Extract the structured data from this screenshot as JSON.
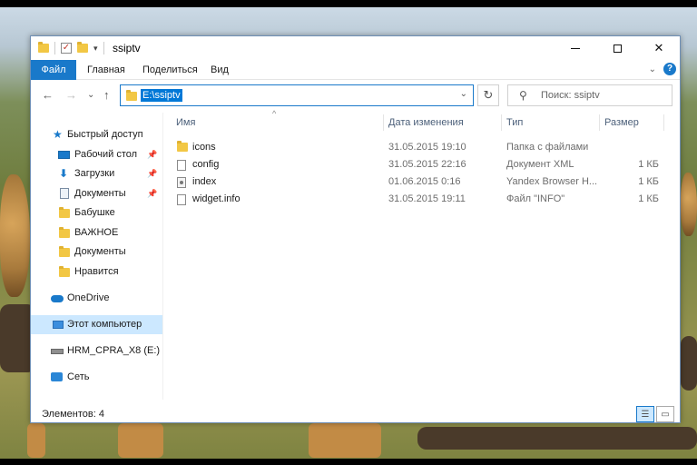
{
  "window": {
    "title": "ssiptv",
    "controls": {
      "minimize": "",
      "maximize": "",
      "close": "✕"
    }
  },
  "ribbon": {
    "tabs": [
      {
        "label": "Файл"
      },
      {
        "label": "Главная"
      },
      {
        "label": "Поделиться"
      },
      {
        "label": "Вид"
      }
    ],
    "help": "?"
  },
  "navigation": {
    "back": "←",
    "forward": "→",
    "recent": "⌄",
    "up": "↑",
    "address_path": "E:\\ssiptv",
    "refresh": "↻",
    "search_placeholder": "Поиск: ssiptv"
  },
  "sidebar": {
    "quick_access": "Быстрый доступ",
    "items": [
      {
        "label": "Рабочий стол",
        "icon": "desktop-icon",
        "pinned": true
      },
      {
        "label": "Загрузки",
        "icon": "download-icon",
        "pinned": true
      },
      {
        "label": "Документы",
        "icon": "document-icon",
        "pinned": true
      },
      {
        "label": "Бабушке",
        "icon": "folder-icon",
        "pinned": false
      },
      {
        "label": "ВАЖНОЕ",
        "icon": "folder-icon",
        "pinned": false
      },
      {
        "label": "Документы",
        "icon": "folder-icon",
        "pinned": false
      },
      {
        "label": "Нравится",
        "icon": "folder-icon",
        "pinned": false
      }
    ],
    "onedrive": "OneDrive",
    "this_pc": "Этот компьютер",
    "drive": "HRM_CPRA_X8 (E:)",
    "network": "Сеть"
  },
  "filelist": {
    "columns": {
      "name": "Имя",
      "date": "Дата изменения",
      "type": "Тип",
      "size": "Размер"
    },
    "rows": [
      {
        "name": "icons",
        "date": "31.05.2015 19:10",
        "type": "Папка с файлами",
        "size": "",
        "icon": "folder-icon"
      },
      {
        "name": "config",
        "date": "31.05.2015 22:16",
        "type": "Документ XML",
        "size": "1 КБ",
        "icon": "xml-file-icon"
      },
      {
        "name": "index",
        "date": "01.06.2015 0:16",
        "type": "Yandex Browser H...",
        "size": "1 КБ",
        "icon": "html-file-icon"
      },
      {
        "name": "widget.info",
        "date": "31.05.2015 19:11",
        "type": "Файл \"INFO\"",
        "size": "1 КБ",
        "icon": "file-icon"
      }
    ]
  },
  "statusbar": {
    "items_count": "Элементов: 4"
  },
  "colors": {
    "accent": "#1979ca",
    "selection": "#cce8ff",
    "folder": "#f2c744"
  }
}
